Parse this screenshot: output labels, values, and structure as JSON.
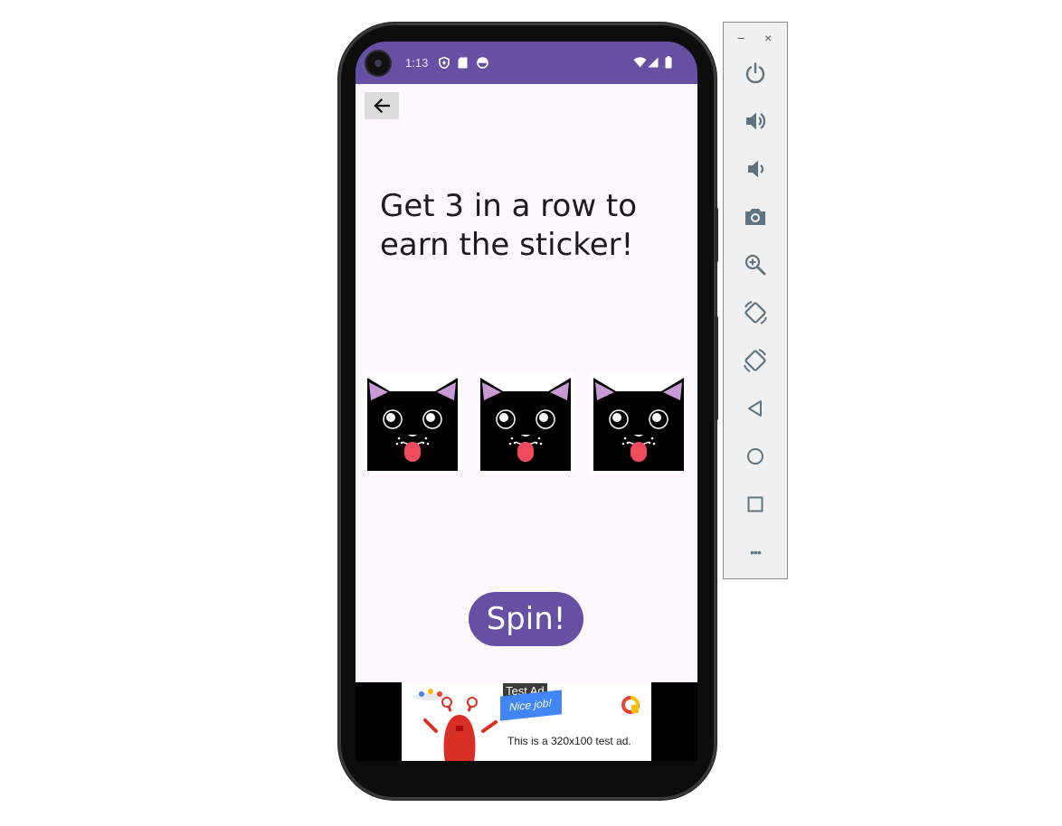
{
  "status_bar": {
    "time": "1:13",
    "icons": [
      "shield-icon",
      "sd-card-icon",
      "face-icon",
      "wifi-icon",
      "signal-icon",
      "battery-icon"
    ],
    "background": "#6750a4"
  },
  "app": {
    "back_icon": "arrow-left-icon",
    "headline": "Get 3 in a row to earn the sticker!",
    "reels": [
      {
        "symbol": "black-cat-sticker"
      },
      {
        "symbol": "black-cat-sticker"
      },
      {
        "symbol": "black-cat-sticker"
      }
    ],
    "spin_label": "Spin!",
    "accent": "#6750a4",
    "background": "#fdf7fe"
  },
  "ad": {
    "badge": "Test Ad",
    "banner_text": "Nice job!",
    "description": "This is a 320x100 test ad."
  },
  "emulator_toolbar": {
    "window_controls": [
      "−",
      "×"
    ],
    "buttons": [
      {
        "icon": "power-icon"
      },
      {
        "icon": "volume-up-icon"
      },
      {
        "icon": "volume-down-icon"
      },
      {
        "icon": "camera-icon"
      },
      {
        "icon": "zoom-icon"
      },
      {
        "icon": "rotate-left-icon"
      },
      {
        "icon": "rotate-right-icon"
      },
      {
        "icon": "back-triangle-icon"
      },
      {
        "icon": "home-circle-icon"
      },
      {
        "icon": "overview-square-icon"
      },
      {
        "icon": "more-icon"
      }
    ],
    "more_label": "•••"
  }
}
